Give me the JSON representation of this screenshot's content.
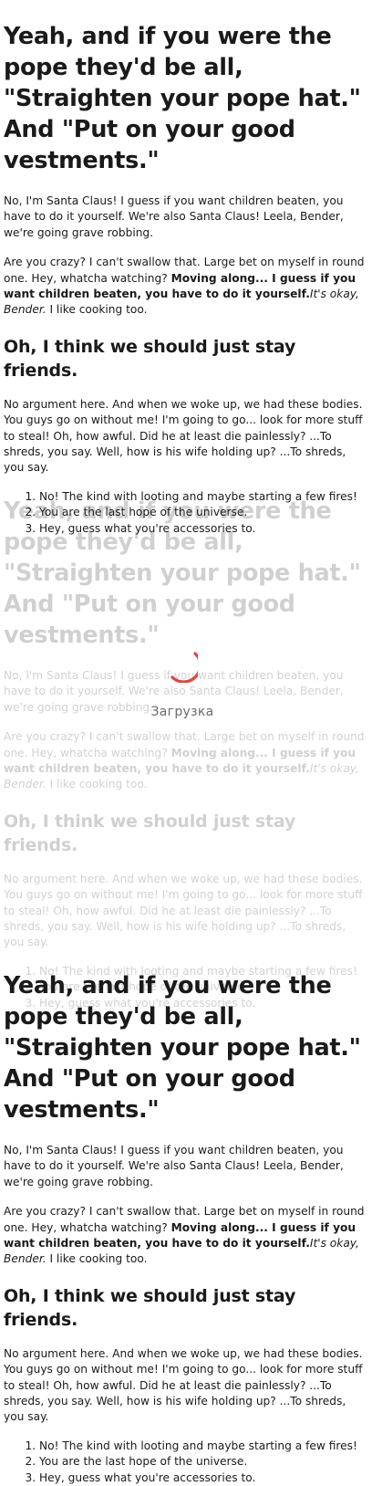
{
  "article": {
    "heading": "Yeah, and if you were the pope they'd be all, \"Straighten your pope hat.\" And \"Put on your good vestments.\"",
    "paragraph1": "No, I'm Santa Claus! I guess if you want children beaten, you have to do it yourself. We're also Santa Claus! Leela, Bender, we're going grave robbing.",
    "paragraph2_start": "Are you crazy? I can't swallow that. Large bet on myself in round one. Hey, whatcha watching? ",
    "paragraph2_bold": "Moving along... I guess if you want children beaten, you have to do it yourself.",
    "paragraph2_italic": "It's okay, Bender.",
    "paragraph2_end": " I like cooking too.",
    "subheading": "Oh, I think we should just stay friends.",
    "paragraph3": "No argument here. And when we woke up, we had these bodies. You guys go on without me! I'm going to go... look for more stuff to steal! Oh, how awful. Did he at least die painlessly? ...To shreds, you say. Well, how is his wife holding up? ...To shreds, you say.",
    "list": [
      "No! The kind with looting and maybe starting a few fires!",
      "You are the last hope of the universe.",
      "Hey, guess what you're accessories to."
    ]
  },
  "loader": {
    "text": "Загрузка",
    "spinner_color": "#e0453d"
  },
  "colors": {
    "text": "#1a1a1a",
    "background": "#ffffff"
  }
}
